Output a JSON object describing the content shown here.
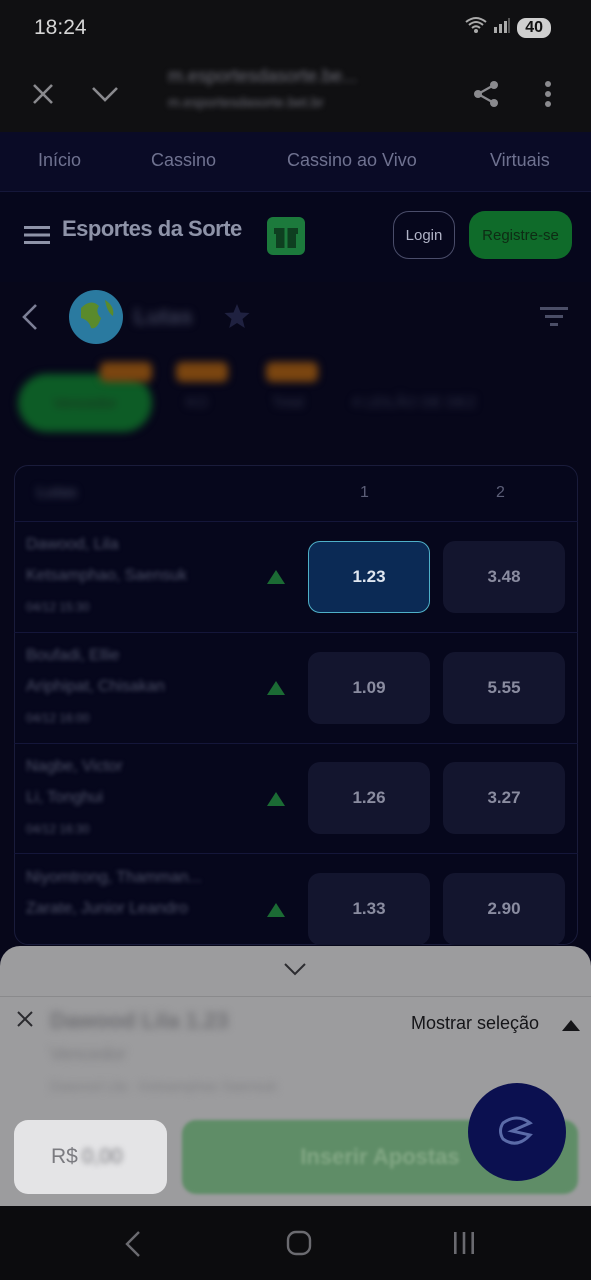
{
  "status_bar": {
    "time": "18:24",
    "battery": "40"
  },
  "browser": {
    "url_title": "m.esportesdasorte.be...",
    "url_sub": "m.esportesdasorte.bet.br"
  },
  "top_nav": {
    "items": [
      "Início",
      "Cassino",
      "Cassino ao Vivo",
      "Virtuais"
    ]
  },
  "header": {
    "logo": "Esportes da Sorte",
    "login": "Login",
    "register": "Registre-se"
  },
  "league": {
    "name": "Lutas"
  },
  "tabs": [
    "Vencedor",
    "KO",
    "Total",
    "4 LEILÃO DE DEZ"
  ],
  "table": {
    "col_header": "Lutas",
    "col_1": "1",
    "col_2": "2",
    "rows": [
      {
        "fighter1": "Dawood, Lila",
        "fighter2": "Ketsamphao, Saensuk",
        "meta": "04/12 15:30",
        "odd1": "1.23",
        "odd2": "3.48",
        "selected": true
      },
      {
        "fighter1": "Boufadi, Ellie",
        "fighter2": "Ariphipat, Chisakan",
        "meta": "04/12 16:00",
        "odd1": "1.09",
        "odd2": "5.55",
        "selected": false
      },
      {
        "fighter1": "Nagbe, Victor",
        "fighter2": "Li, Tonghui",
        "meta": "04/12 16:30",
        "odd1": "1.26",
        "odd2": "3.27",
        "selected": false
      },
      {
        "fighter1": "Niyomtrong, Thamman...",
        "fighter2": "Zarate, Junior Leandro",
        "meta": "04/12 17:00",
        "odd1": "1.33",
        "odd2": "2.90",
        "selected": false
      }
    ]
  },
  "bet_slip": {
    "selection_title": "Dawood Lila 1.23",
    "market": "Vencedor",
    "match": "Dawood Lila - Ketsamphao Saensuk",
    "show_selection": "Mostrar seleção",
    "amount_prefix": "R$",
    "amount_value": "0,00",
    "insert_button": "Inserir Apostas"
  },
  "colors": {
    "accent_green": "#1c9a3e",
    "selected_odd": "#0b2a55",
    "background": "#07071a"
  }
}
